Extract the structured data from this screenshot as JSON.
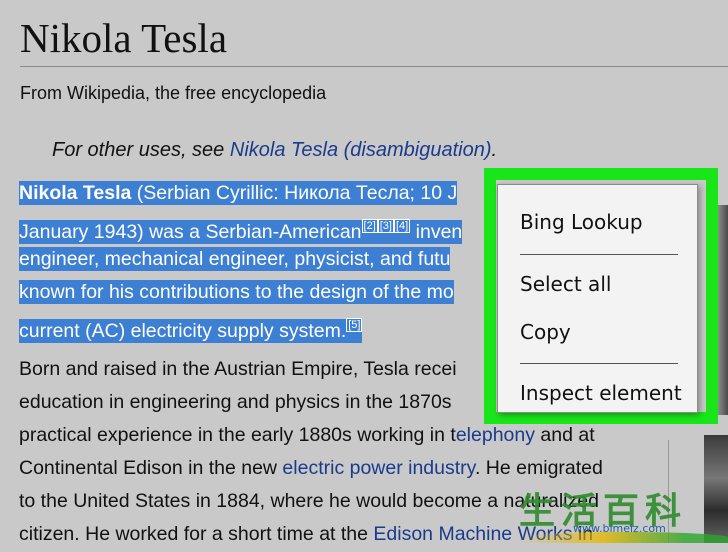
{
  "article": {
    "title": "Nikola Tesla",
    "subtitle": "From Wikipedia, the free encyclopedia",
    "hatnote": {
      "prefix": "For other uses, see ",
      "link": "Nikola Tesla (disambiguation)",
      "suffix": "."
    },
    "lead": {
      "line1_bold": "Nikola Tesla",
      "line1_rest": " (Serbian Cyrillic: Никола Тесла; 10 J",
      "line2_a": "January 1943) was a Serbian-American",
      "line2_refs": [
        "[2]",
        "[3]",
        "[4]"
      ],
      "line2_b": " inven",
      "line3": "engineer, mechanical engineer, physicist, and futu",
      "line4": "known for his contributions to the design of the mo",
      "line5": "current (AC) electricity supply system.",
      "line5_ref": "[5]"
    },
    "body": {
      "l1": "Born and raised in the Austrian Empire, Tesla recei",
      "l2": "education in engineering and physics in the 1870s",
      "l3_a": "practical experience in the early 1880s working in t",
      "l3_link": "elephony",
      "l3_b": " and at",
      "l4_a": "Continental Edison in the new ",
      "l4_link": "electric power industry",
      "l4_b": ". He emigrated",
      "l5": "to the United States in 1884, where he would become a",
      "l5_b": " naturalized",
      "l6_a": "citizen. He worked for a short time at the ",
      "l6_link": "Edison Machine Works",
      "l6_b": " in"
    }
  },
  "context_menu": {
    "items": [
      "Bing Lookup",
      "Select all",
      "Copy",
      "Inspect element"
    ]
  },
  "watermark": {
    "chars": "生活百科",
    "url": "www.bimeiz.com"
  },
  "colors": {
    "page_bg": "#c9c9c9",
    "selection": "#3d7fd3",
    "link": "#1a3a8c",
    "highlight_frame": "#19e619"
  }
}
